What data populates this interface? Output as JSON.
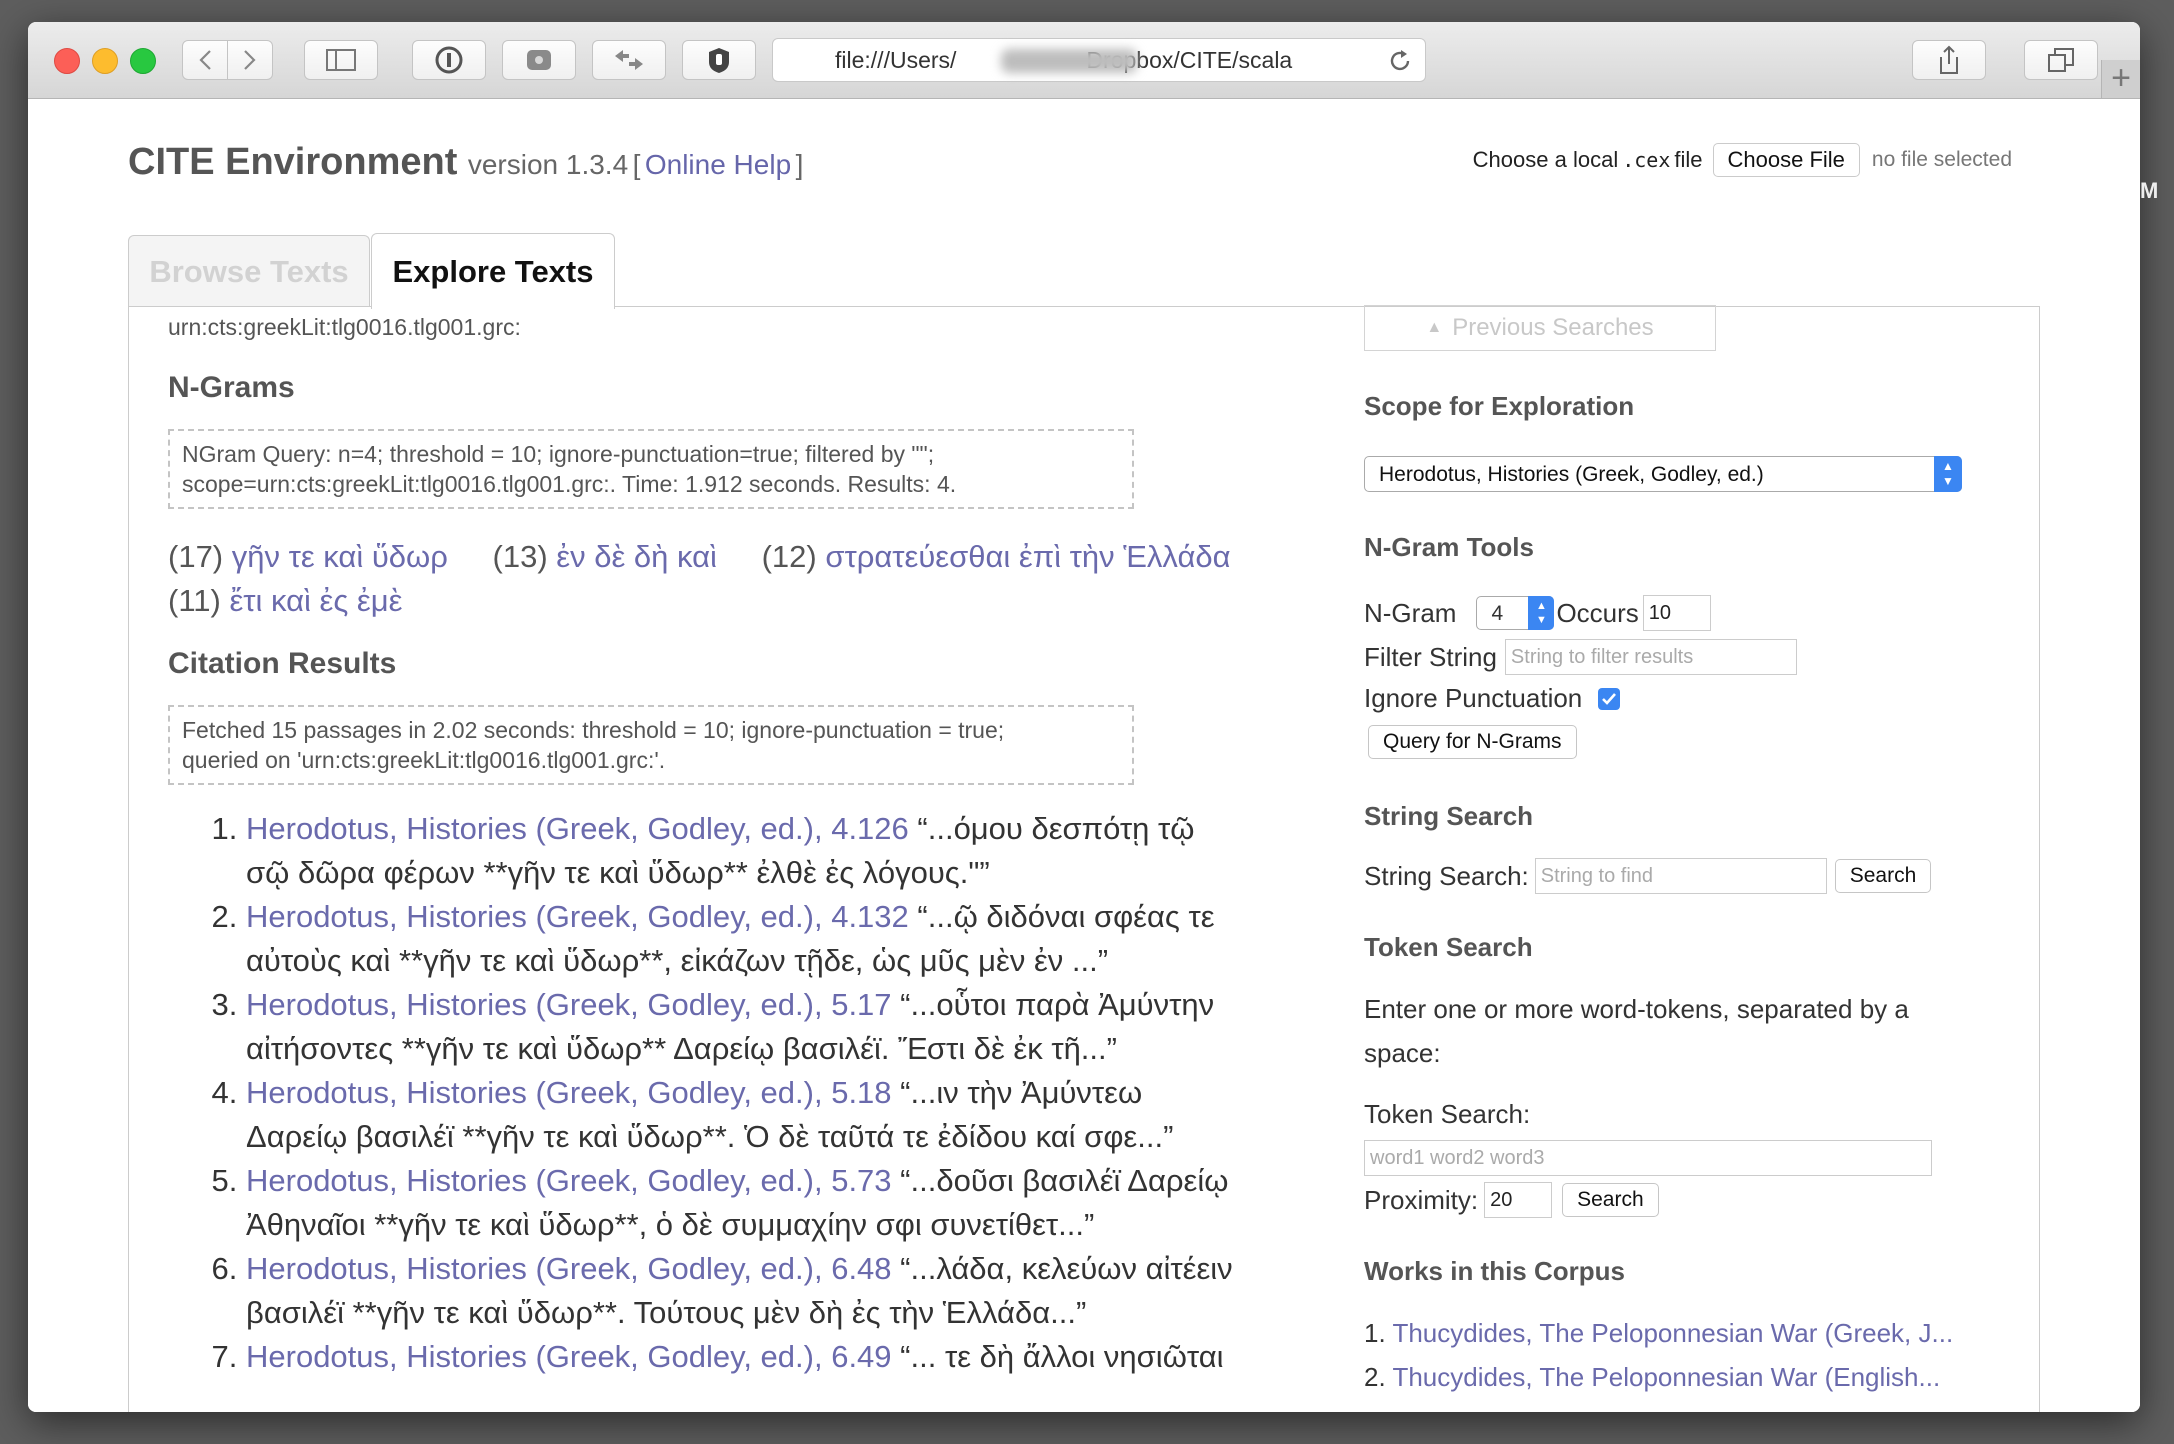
{
  "browser": {
    "url": "file:///Users/          Dropbox/CITE/scala",
    "url_prefix": "file:///Users/",
    "url_suffix": "Dropbox/CITE/scala"
  },
  "header": {
    "title": "CITE Environment",
    "version": "version 1.3.4",
    "bracket_open": "[",
    "help_link": "Online Help",
    "bracket_close": "]",
    "file_prompt_pre": "Choose a local",
    "file_ext": ".cex",
    "file_prompt_post": "file",
    "choose_file_button": "Choose File",
    "no_file_text": "no file selected"
  },
  "tabs": [
    {
      "label": "Browse Texts",
      "active": false
    },
    {
      "label": "Explore Texts",
      "active": true
    }
  ],
  "main": {
    "urn": "urn:cts:greekLit:tlg0016.tlg001.grc:",
    "ngrams_heading": "N-Grams",
    "ngram_query_line1": "NGram Query: n=4; threshold = 10; ignore-punctuation=true; filtered by \"\";",
    "ngram_query_line2": "scope=urn:cts:greekLit:tlg0016.tlg001.grc:. Time: 1.912 seconds. Results: 4.",
    "ngrams": [
      {
        "count": "(17)",
        "text": "γῆν τε καὶ ὕδωρ"
      },
      {
        "count": "(13)",
        "text": "ἐν δὲ δὴ καὶ"
      },
      {
        "count": "(12)",
        "text": "στρατεύεσθαι ἐπὶ τὴν Ἑλλάδα"
      },
      {
        "count": "(11)",
        "text": "ἔτι καὶ ἐς ἐμὲ"
      }
    ],
    "citations_heading": "Citation Results",
    "citation_query_line1": "Fetched 15 passages in 2.02 seconds: threshold = 10; ignore-punctuation = true;",
    "citation_query_line2": "queried on 'urn:cts:greekLit:tlg0016.tlg001.grc:'.",
    "citations": [
      {
        "ref": "Herodotus, Histories (Greek, Godley, ed.), 4.126",
        "snippet": "“...όμου δεσπότῃ τῷ σῷ δῶρα φέρων **γῆν τε καὶ ὕδωρ** ἐλθὲ ἐς λόγους.\"”"
      },
      {
        "ref": "Herodotus, Histories (Greek, Godley, ed.), 4.132",
        "snippet": "“...ῷ διδόναι σφέας τε αὐτοὺς καὶ **γῆν τε καὶ ὕδωρ**, εἰκάζων τῇδε, ὡς μῦς μὲν ἐν ...”"
      },
      {
        "ref": "Herodotus, Histories (Greek, Godley, ed.), 5.17",
        "snippet": "“...οὗτοι παρὰ Ἀμύντην αἰτήσοντες **γῆν τε καὶ ὕδωρ** Δαρείῳ βασιλέϊ. Ἔστι δὲ ἐκ τῆ...”"
      },
      {
        "ref": "Herodotus, Histories (Greek, Godley, ed.), 5.18",
        "snippet": "“...ιν τὴν Ἀμύντεω Δαρείῳ βασιλέϊ **γῆν τε καὶ ὕδωρ**. Ὁ δὲ ταῦτά τε ἐδίδου καί σφε...”"
      },
      {
        "ref": "Herodotus, Histories (Greek, Godley, ed.), 5.73",
        "snippet": "“...δοῦσι βασιλέϊ Δαρείῳ Ἀθηναῖοι **γῆν τε καὶ ὕδωρ**, ὁ δὲ συμμαχίην σφι συνετίθετ...”"
      },
      {
        "ref": "Herodotus, Histories (Greek, Godley, ed.), 6.48",
        "snippet": "“...λάδα, κελεύων αἰτέειν βασιλέϊ **γῆν τε καὶ ὕδωρ**. Τούτους μὲν δὴ ἐς τὴν Ἑλλάδα...”"
      },
      {
        "ref": "Herodotus, Histories (Greek, Godley, ed.), 6.49",
        "snippet": "“... τε δὴ ἄλλοι νησιῶται"
      }
    ]
  },
  "sidebar": {
    "previous_searches": "Previous Searches",
    "scope_heading": "Scope for Exploration",
    "scope_selected": "Herodotus, Histories (Greek, Godley, ed.)",
    "ngram_tools_heading": "N-Gram Tools",
    "ngram_label": "N-Gram",
    "ngram_value": "4",
    "occurs_label": "Occurs",
    "occurs_value": "10",
    "filter_label": "Filter String",
    "filter_placeholder": "String to filter results",
    "ignore_punct_label": "Ignore Punctuation",
    "ignore_punct_checked": true,
    "query_ngrams_button": "Query for N-Grams",
    "string_search_heading": "String Search",
    "string_search_label": "String Search:",
    "string_search_placeholder": "String to find",
    "string_search_button": "Search",
    "token_search_heading": "Token Search",
    "token_search_desc": "Enter one or more word-tokens, separated by a space:",
    "token_search_label": "Token Search:",
    "token_search_placeholder": "word1 word2 word3",
    "proximity_label": "Proximity:",
    "proximity_value": "20",
    "token_search_button": "Search",
    "works_heading": "Works in this Corpus",
    "works": [
      {
        "num": "1.",
        "title": "Thucydides, The Peloponnesian War (Greek, J..."
      },
      {
        "num": "2.",
        "title": "Thucydides, The Peloponnesian War (English..."
      }
    ]
  },
  "colors": {
    "link": "#6a6aac",
    "accent": "#3b86f2"
  }
}
